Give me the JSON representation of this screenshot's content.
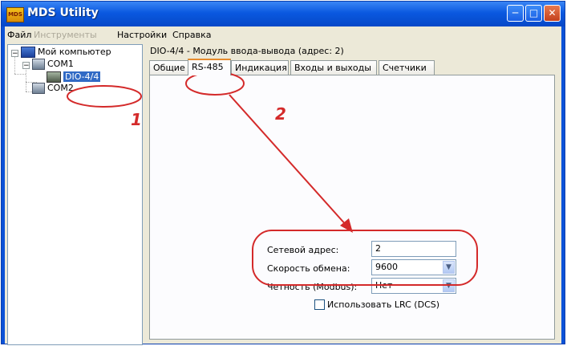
{
  "window": {
    "title": "MDS Utility",
    "app_icon_text": "MDS"
  },
  "menu": {
    "file": "Файл",
    "tools": "Инструменты",
    "settings": "Настройки",
    "help": "Справка"
  },
  "tree": {
    "root": "Мой компьютер",
    "com1": "COM1",
    "device": "DIO-4/4",
    "com2": "COM2"
  },
  "panel": {
    "header": "DIO-4/4 - Модуль ввода-вывода (адрес: 2)",
    "tabs": [
      "Общие",
      "RS-485",
      "Индикация",
      "Входы и выходы",
      "Счетчики"
    ],
    "active_tab": "RS-485"
  },
  "form": {
    "address_label": "Сетевой адрес:",
    "address_value": "2",
    "speed_label": "Скорость обмена:",
    "speed_value": "9600",
    "parity_label": "Четность (Modbus):",
    "parity_value": "Нет",
    "lrc_label": "Использовать LRC (DCS)",
    "lrc_checked": false
  },
  "annotations": {
    "one": "1",
    "two": "2"
  },
  "colors": {
    "annotation": "#d42a2a",
    "selection": "#316ac5",
    "title_bar": "#0a58e0"
  }
}
